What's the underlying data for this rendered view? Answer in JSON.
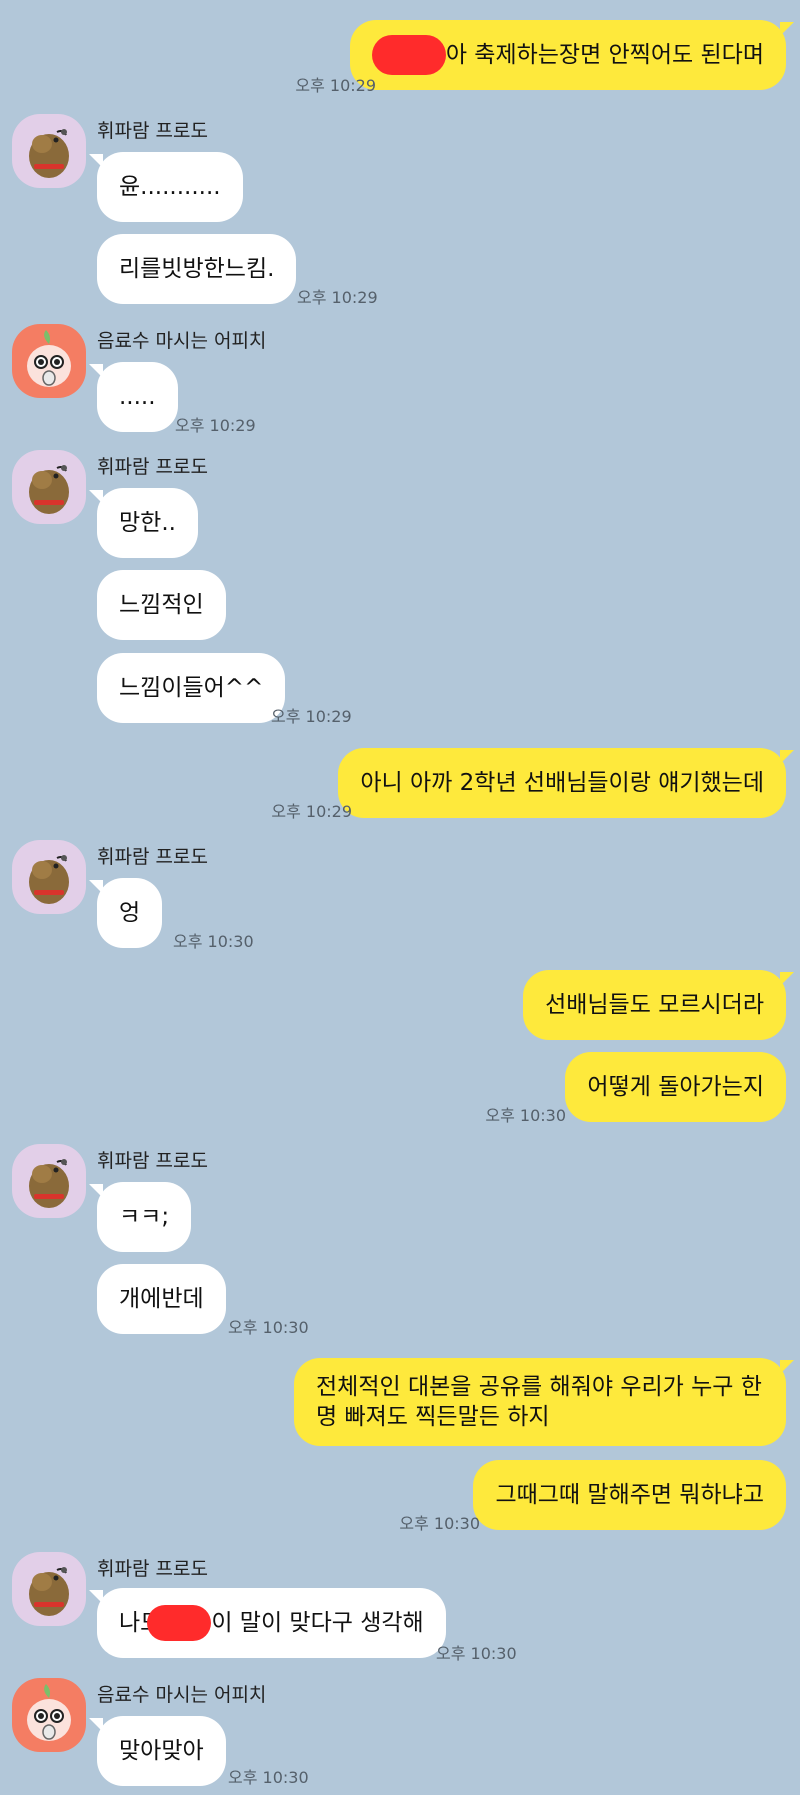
{
  "senders": {
    "frodo": "휘파람 프로도",
    "apeach": "음료수 마시는 어피치"
  },
  "messages": {
    "m1": {
      "text_after": "아 축제하는장면 안찍어도 된다며",
      "time": "오후 10:29"
    },
    "m2": {
      "text": "윤...........",
      "time": ""
    },
    "m3": {
      "text": "리를빗방한느킴.",
      "time": "오후 10:29"
    },
    "m4": {
      "text": ".....",
      "time": "오후 10:29"
    },
    "m5": {
      "text": "망한.."
    },
    "m6": {
      "text": "느낌적인"
    },
    "m7": {
      "text": "느낌이들어^^",
      "time": "오후 10:29"
    },
    "m8": {
      "text": "아니 아까 2학년 선배님들이랑 얘기했는데",
      "time": "오후 10:29"
    },
    "m9": {
      "text": "엉",
      "time": "오후 10:30"
    },
    "m10": {
      "text": "선배님들도 모르시더라"
    },
    "m11": {
      "text": "어떻게 돌아가는지",
      "time": "오후 10:30"
    },
    "m12": {
      "text": "ㅋㅋ;"
    },
    "m13": {
      "text": "개에반데",
      "time": "오후 10:30"
    },
    "m14": {
      "text": "전체적인 대본을 공유를 해줘야 우리가 누구 한명 빠져도 찍든말든 하지"
    },
    "m15": {
      "text": "그때그때 말해주면 뭐하냐고",
      "time": "오후 10:30"
    },
    "m16": {
      "text_before": "나도",
      "text_after": "이 말이 맞다구 생각해",
      "time": "오후 10:30"
    },
    "m17": {
      "text": "맞아맞아",
      "time": "오후 10:30"
    }
  },
  "colors": {
    "background": "#b2c7d9",
    "incoming_bubble": "#ffffff",
    "outgoing_bubble": "#fee93c",
    "redaction": "#ff2b2b"
  },
  "icons": {
    "frodo_avatar": "frodo-avatar-icon",
    "apeach_avatar": "apeach-avatar-icon"
  }
}
